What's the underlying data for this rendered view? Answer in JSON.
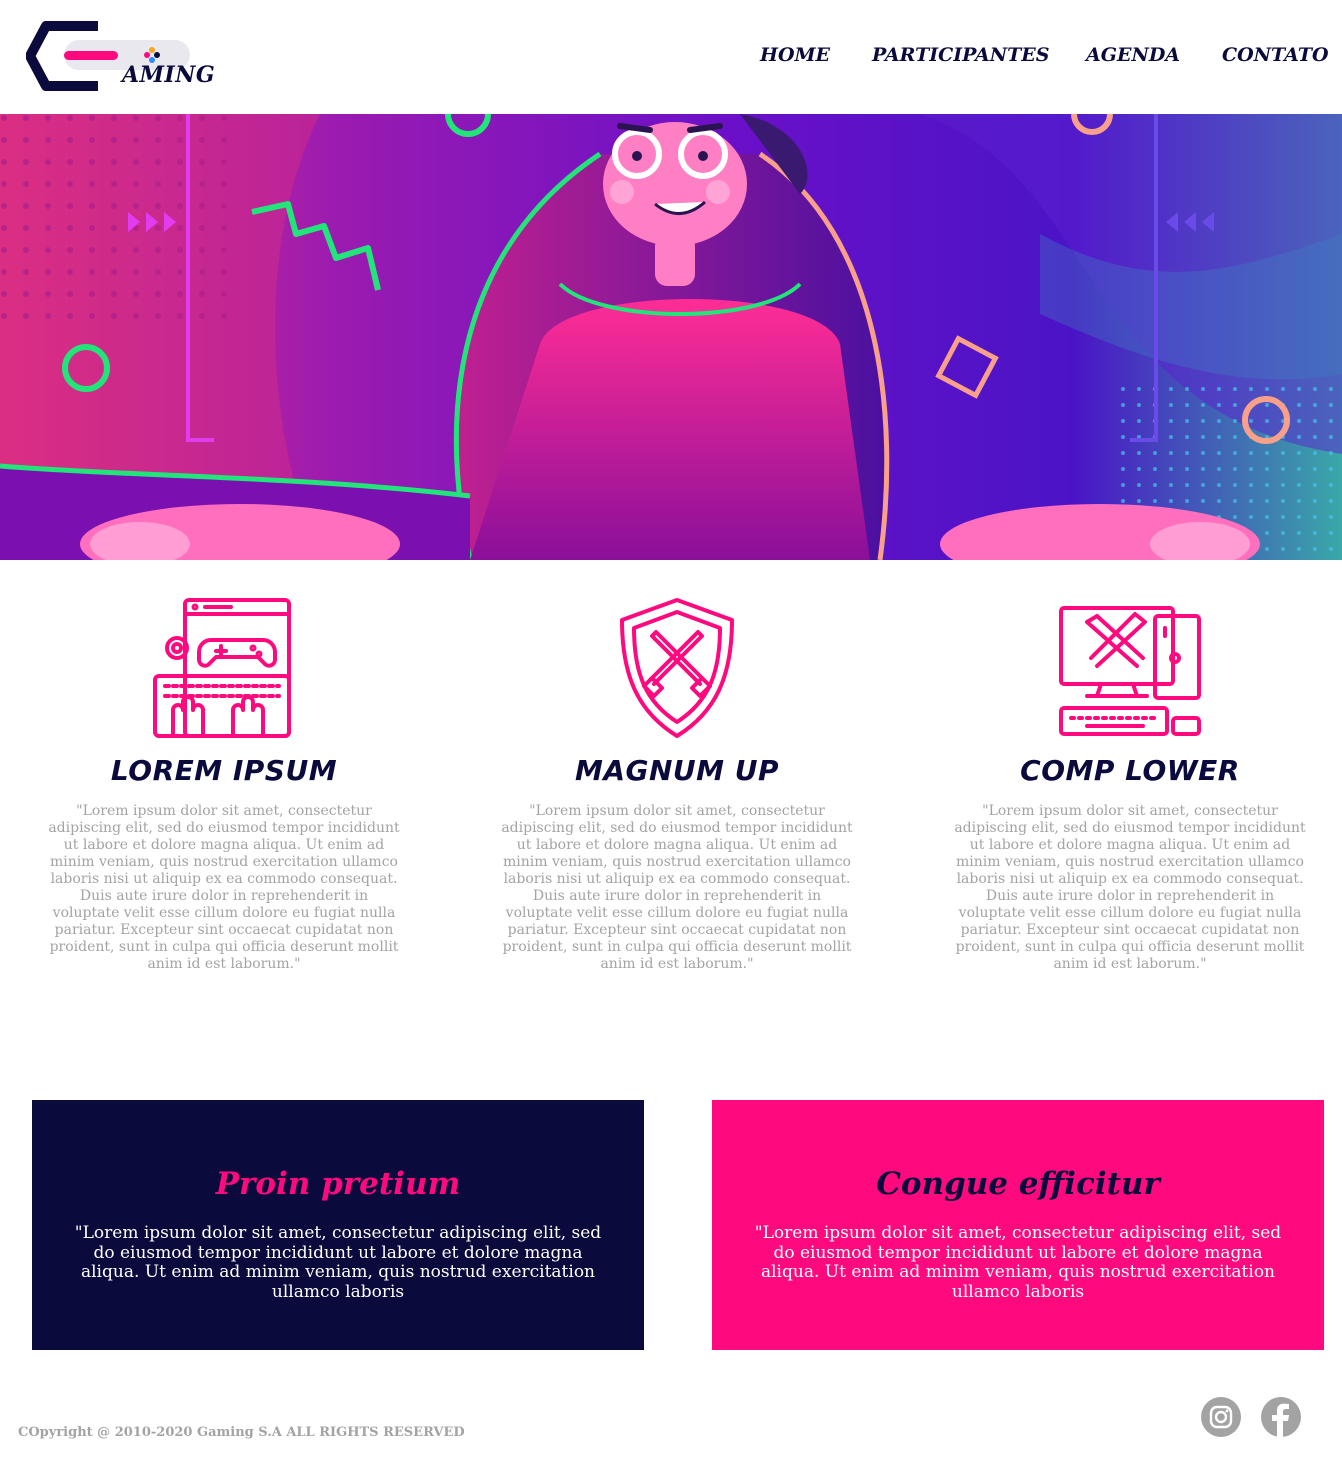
{
  "brand": {
    "logo_text": "AMING",
    "logo_alt": "Gaming"
  },
  "nav": {
    "items": [
      {
        "label": "HOME"
      },
      {
        "label": "PARTICIPANTES"
      },
      {
        "label": "AGENDA"
      },
      {
        "label": "CONTATO"
      }
    ]
  },
  "hero": {
    "illustration": "gamer-character-illustration"
  },
  "features": [
    {
      "icon": "gaming-keyboard-controller-icon",
      "title": "LOREM IPSUM",
      "text": "\"Lorem ipsum dolor sit amet, consectetur adipiscing elit, sed do eiusmod tempor incididunt ut labore et dolore magna aliqua. Ut enim ad minim veniam, quis nostrud exercitation ullamco laboris nisi ut aliquip ex ea commodo consequat. Duis aute irure dolor in reprehenderit in voluptate velit esse cillum dolore eu fugiat nulla pariatur. Excepteur sint occaecat cupidatat non proident, sunt in culpa qui officia deserunt mollit anim id est laborum.\""
    },
    {
      "icon": "shield-swords-icon",
      "title": "MAGNUM UP",
      "text": "\"Lorem ipsum dolor sit amet, consectetur adipiscing elit, sed do eiusmod tempor incididunt ut labore et dolore magna aliqua. Ut enim ad minim veniam, quis nostrud exercitation ullamco laboris nisi ut aliquip ex ea commodo consequat. Duis aute irure dolor in reprehenderit in voluptate velit esse cillum dolore eu fugiat nulla pariatur. Excepteur sint occaecat cupidatat non proident, sunt in culpa qui officia deserunt mollit anim id est laborum.\""
    },
    {
      "icon": "computer-swords-icon",
      "title": "COMP LOWER",
      "text": "\"Lorem ipsum dolor sit amet, consectetur adipiscing elit, sed do eiusmod tempor incididunt ut labore et dolore magna aliqua. Ut enim ad minim veniam, quis nostrud exercitation ullamco laboris nisi ut aliquip ex ea commodo consequat. Duis aute irure dolor in reprehenderit in voluptate velit esse cillum dolore eu fugiat nulla pariatur. Excepteur sint occaecat cupidatat non proident, sunt in culpa qui officia deserunt mollit anim id est laborum.\""
    }
  ],
  "cards": [
    {
      "title": "Proin pretium",
      "text": "\"Lorem ipsum dolor sit amet, consectetur adipiscing elit, sed do eiusmod tempor incididunt ut labore et dolore magna aliqua. Ut enim ad minim veniam, quis nostrud exercitation ullamco laboris"
    },
    {
      "title": "Congue efficitur",
      "text": "\"Lorem ipsum dolor sit amet, consectetur adipiscing elit, sed do eiusmod tempor incididunt ut labore et dolore magna aliqua. Ut enim ad minim veniam, quis nostrud exercitation ullamco laboris"
    }
  ],
  "footer": {
    "copyright": "COpyright @ 2010-2020 Gaming S.A ALL RIGHTS RESERVED",
    "social": [
      {
        "icon": "instagram-icon"
      },
      {
        "icon": "facebook-icon"
      }
    ]
  },
  "colors": {
    "navy": "#0a0a3c",
    "pink": "#ff0a7e",
    "gray": "#a3a3a3"
  }
}
